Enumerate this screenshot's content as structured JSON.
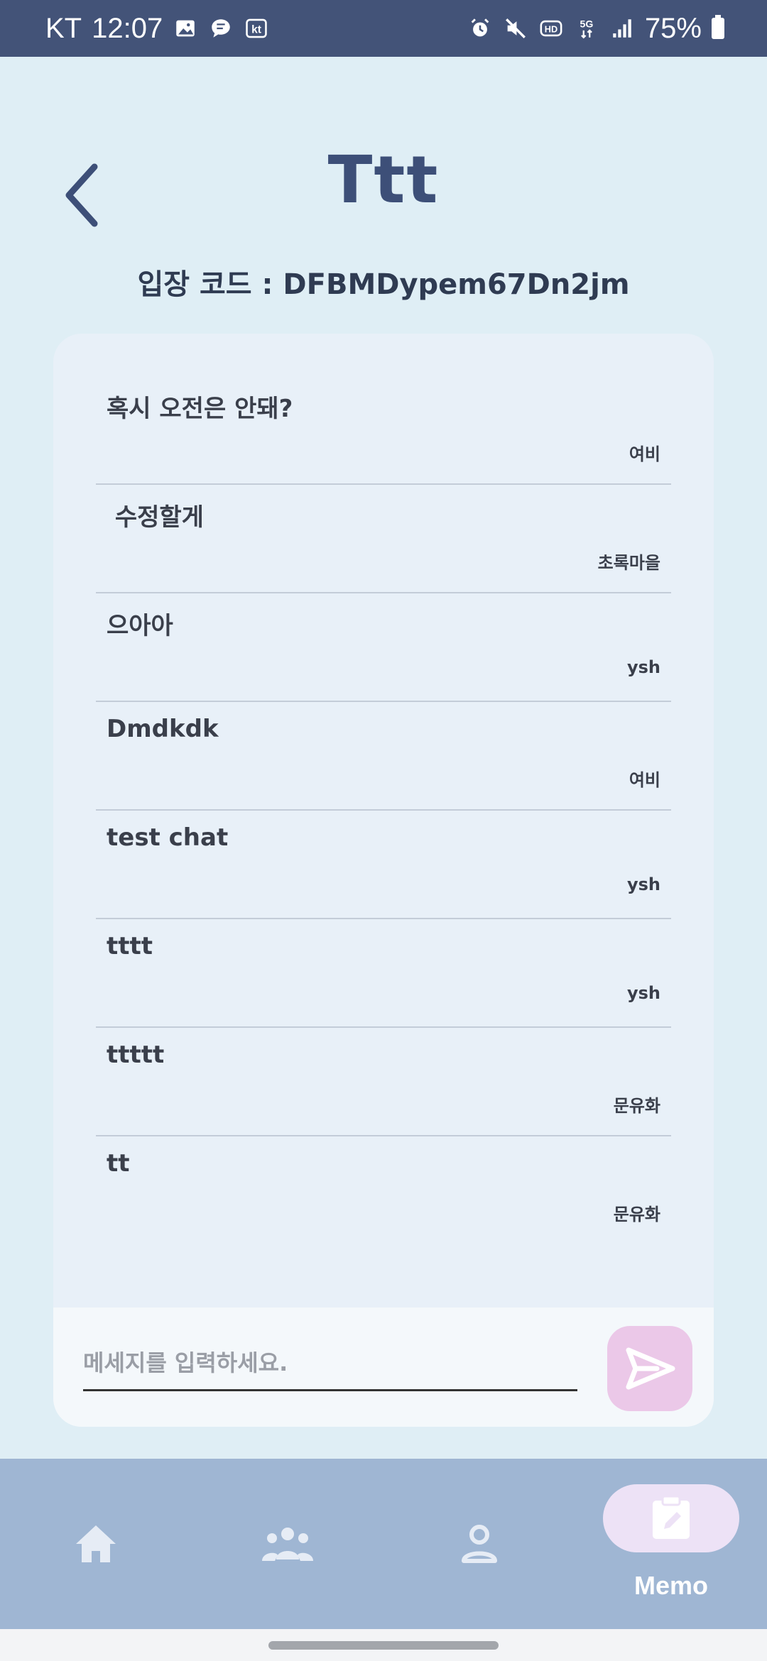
{
  "status_bar": {
    "carrier": "KT",
    "time": "12:07",
    "notification_icons": [
      "gallery-icon",
      "chat-bubble-icon",
      "kt-icon"
    ],
    "system_icons": [
      "alarm-icon",
      "mute-icon",
      "hd-icon",
      "5g-icon",
      "signal-icon"
    ],
    "battery": "75%",
    "hd_label": "HD",
    "fiveg_label": "5G",
    "kt_label": "kt"
  },
  "header": {
    "title": "Ttt",
    "entry_code": "입장 코드 : DFBMDypem67Dn2jm"
  },
  "messages": [
    {
      "text": "혹시 오전은 안돼?",
      "author": "여비"
    },
    {
      "text": " 수정할게",
      "author": "초록마을"
    },
    {
      "text": "으아아",
      "author": "ysh"
    },
    {
      "text": "Dmdkdk",
      "author": "여비"
    },
    {
      "text": "test chat",
      "author": "ysh"
    },
    {
      "text": "tttt",
      "author": "ysh"
    },
    {
      "text": "ttttt",
      "author": "문유화"
    },
    {
      "text": "tt",
      "author": "문유화"
    }
  ],
  "input": {
    "placeholder": "메세지를 입력하세요.",
    "value": ""
  },
  "nav": {
    "items": [
      "home-icon",
      "group-icon",
      "profile-icon",
      "memo-icon"
    ],
    "active": "memo",
    "memo_label": "Memo"
  },
  "colors": {
    "status_bar": "#435378",
    "background": "#dfeef5",
    "panel": "#e8f0f8",
    "title": "#3d4f78",
    "send_button": "#ebc8e8",
    "nav_bar": "#9fb6d3",
    "memo_pill": "#ede2f6"
  }
}
